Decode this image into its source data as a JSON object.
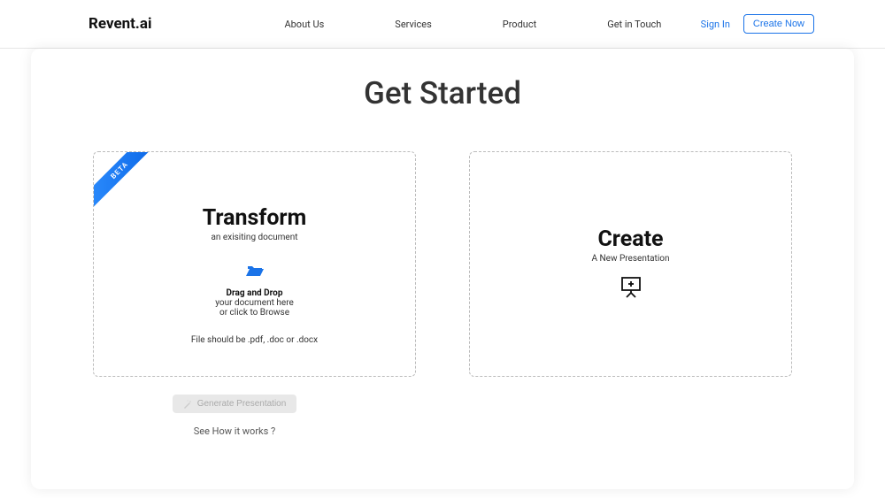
{
  "header": {
    "logo": "Revent.ai",
    "nav": {
      "about": "About Us",
      "services": "Services",
      "product": "Product",
      "contact": "Get in Touch"
    },
    "signin": "Sign In",
    "create_now": "Create Now"
  },
  "page": {
    "title": "Get Started"
  },
  "cards": {
    "transform": {
      "badge": "BETA",
      "title": "Transform",
      "subtitle": "an exisiting document",
      "drag_label": "Drag and Drop",
      "drag_sub1": "your document here",
      "drag_sub2": "or click to Browse",
      "file_info": "File should be .pdf, .doc or .docx"
    },
    "create": {
      "title": "Create",
      "subtitle": "A New Presentation"
    }
  },
  "actions": {
    "generate": "Generate Presentation",
    "how_works": "See How it works ?"
  }
}
